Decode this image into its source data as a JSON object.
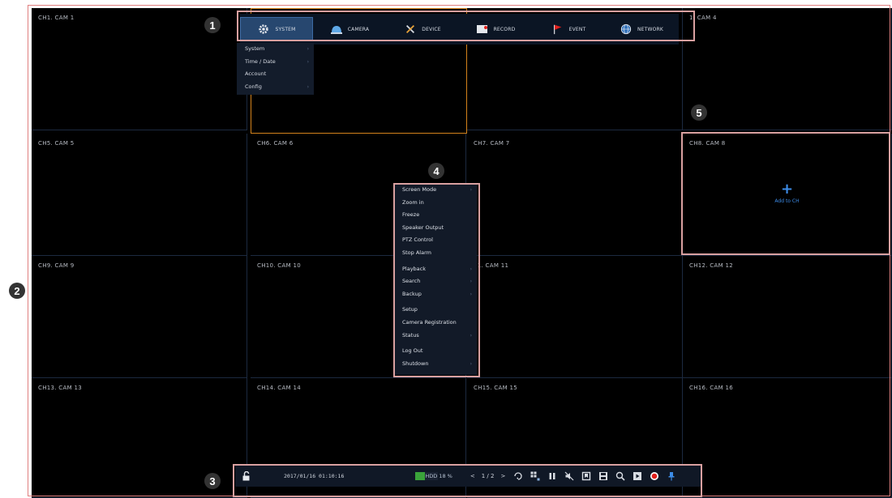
{
  "cameras": [
    {
      "label": "CH1. CAM 1"
    },
    {
      "label": ""
    },
    {
      "label": ""
    },
    {
      "label": "1. CAM 4"
    },
    {
      "label": "CH5. CAM 5"
    },
    {
      "label": "CH6. CAM 6"
    },
    {
      "label": "CH7. CAM 7"
    },
    {
      "label": "CH8. CAM 8"
    },
    {
      "label": "CH9. CAM 9"
    },
    {
      "label": "CH10. CAM 10"
    },
    {
      "label": "11. CAM 11"
    },
    {
      "label": "CH12. CAM 12"
    },
    {
      "label": "CH13. CAM 13"
    },
    {
      "label": "CH14. CAM 14"
    },
    {
      "label": "CH15. CAM 15"
    },
    {
      "label": "CH16. CAM 16"
    }
  ],
  "add_channel": {
    "plus": "+",
    "label": "Add to CH"
  },
  "topbar": {
    "items": [
      {
        "label": "SYSTEM",
        "icon": "gear-icon"
      },
      {
        "label": "CAMERA",
        "icon": "camera-dome-icon"
      },
      {
        "label": "DEVICE",
        "icon": "tools-icon"
      },
      {
        "label": "RECORD",
        "icon": "record-icon"
      },
      {
        "label": "EVENT",
        "icon": "flag-icon"
      },
      {
        "label": "NETWORK",
        "icon": "globe-icon"
      }
    ]
  },
  "system_menu": {
    "items": [
      {
        "label": "System"
      },
      {
        "label": "Time / Date"
      },
      {
        "label": "Account"
      },
      {
        "label": "Config"
      }
    ]
  },
  "context_menu": {
    "items": [
      {
        "label": "Screen Mode"
      },
      {
        "label": "Zoom in"
      },
      {
        "label": "Freeze"
      },
      {
        "label": "Speaker Output"
      },
      {
        "label": "PTZ Control"
      },
      {
        "label": "Stop Alarm"
      },
      {
        "label": "Playback"
      },
      {
        "label": "Search"
      },
      {
        "label": "Backup"
      },
      {
        "label": "Setup"
      },
      {
        "label": "Camera Registration"
      },
      {
        "label": "Status"
      },
      {
        "label": "Log Out"
      },
      {
        "label": "Shutdown"
      }
    ]
  },
  "toolbar": {
    "datetime": "2017/01/16 01:10:16",
    "hdd_label": "HDD 18 %",
    "hdd_percent": 18,
    "page": "1 / 2",
    "prev": "<",
    "next": ">"
  },
  "badges": [
    "1",
    "2",
    "3",
    "4",
    "5"
  ],
  "colors": {
    "selected_cell": "#d4831c",
    "accent": "#3d8ce8",
    "hdd_fill": "#3aa33a",
    "record": "#e0201c"
  }
}
